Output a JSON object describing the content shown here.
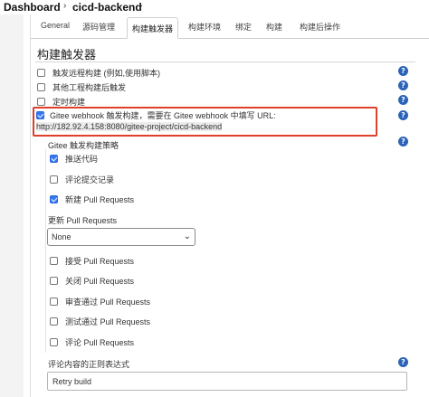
{
  "breadcrumb": {
    "items": [
      "Dashboard",
      "cicd-backend"
    ],
    "separator": "›"
  },
  "tabs": [
    {
      "label": "General",
      "active": false
    },
    {
      "label": "源码管理",
      "active": false
    },
    {
      "label": "构建触发器",
      "active": true
    },
    {
      "label": "构建环境",
      "active": false
    },
    {
      "label": "绑定",
      "active": false
    },
    {
      "label": "构建",
      "active": false
    },
    {
      "label": "构建后操作",
      "active": false
    }
  ],
  "section": {
    "title": "构建触发器"
  },
  "triggers": [
    {
      "label": "触发远程构建 (例如,使用脚本)",
      "checked": false
    },
    {
      "label": "其他工程构建后触发",
      "checked": false
    },
    {
      "label": "定时构建",
      "checked": false
    }
  ],
  "gitee": {
    "checked": true,
    "text": "Gitee webhook 触发构建，需要在 Gitee webhook 中填写 URL: ",
    "url": "http://182.92.4.158:8080/gitee-project/cicd-backend"
  },
  "strategy": {
    "title": "Gitee 触发构建策略",
    "options": [
      {
        "label": "推送代码",
        "checked": true
      },
      {
        "label": "评论提交记录",
        "checked": false
      },
      {
        "label": "新建 Pull Requests",
        "checked": true
      }
    ]
  },
  "update_pr": {
    "label": "更新 Pull Requests",
    "selected": "None"
  },
  "pr_options": [
    {
      "label": "接受 Pull Requests",
      "checked": false
    },
    {
      "label": "关闭 Pull Requests",
      "checked": false
    },
    {
      "label": "审查通过 Pull Requests",
      "checked": false
    },
    {
      "label": "测试通过 Pull Requests",
      "checked": false
    },
    {
      "label": "评论 Pull Requests",
      "checked": false
    }
  ],
  "comment_regex": {
    "label": "评论内容的正则表达式",
    "value": "Retry build"
  },
  "help_icon": "?",
  "colors": {
    "accent": "#3478f6",
    "help": "#2c63b8",
    "highlight_border": "#e0402a"
  }
}
